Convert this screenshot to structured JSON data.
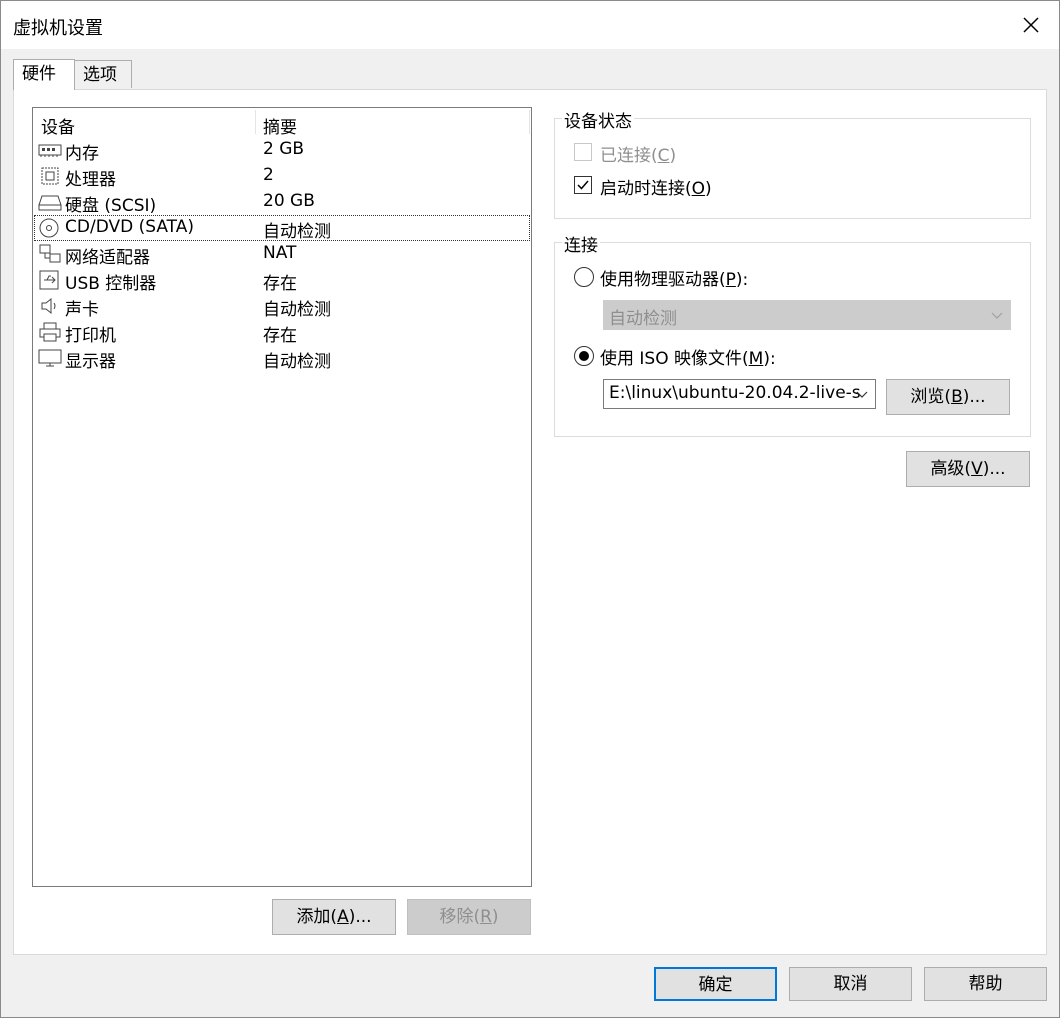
{
  "window": {
    "title": "虚拟机设置"
  },
  "tabs": [
    {
      "label": "硬件"
    },
    {
      "label": "选项"
    }
  ],
  "device_list": {
    "headers": {
      "device": "设备",
      "summary": "摘要"
    },
    "rows": [
      {
        "name": "内存",
        "summary": "2 GB",
        "icon": "memory-icon"
      },
      {
        "name": "处理器",
        "summary": "2",
        "icon": "processor-icon"
      },
      {
        "name": "硬盘 (SCSI)",
        "summary": "20 GB",
        "icon": "hard-disk-icon"
      },
      {
        "name": "CD/DVD (SATA)",
        "summary": "自动检测",
        "icon": "cd-dvd-icon",
        "selected": true
      },
      {
        "name": "网络适配器",
        "summary": "NAT",
        "icon": "network-adapter-icon"
      },
      {
        "name": "USB 控制器",
        "summary": "存在",
        "icon": "usb-icon"
      },
      {
        "name": "声卡",
        "summary": "自动检测",
        "icon": "speaker-icon"
      },
      {
        "name": "打印机",
        "summary": "存在",
        "icon": "printer-icon"
      },
      {
        "name": "显示器",
        "summary": "自动检测",
        "icon": "monitor-icon"
      }
    ]
  },
  "list_buttons": {
    "add": {
      "text": "添加(",
      "key": "A",
      "suffix": ")..."
    },
    "remove": {
      "text": "移除(",
      "key": "R",
      "suffix": ")"
    }
  },
  "device_status": {
    "title": "设备状态",
    "connected": {
      "text": "已连接(",
      "key": "C",
      "suffix": ")",
      "checked": false,
      "enabled": false
    },
    "connect_at_power_on": {
      "text": "启动时连接(",
      "key": "O",
      "suffix": ")",
      "checked": true,
      "enabled": true
    }
  },
  "connection": {
    "title": "连接",
    "physical": {
      "text": "使用物理驱动器(",
      "key": "P",
      "suffix": "):",
      "selected": false
    },
    "physical_drive_value": "自动检测",
    "iso": {
      "text": "使用 ISO 映像文件(",
      "key": "M",
      "suffix": "):",
      "selected": true
    },
    "iso_path": "E:\\linux\\ubuntu-20.04.2-live-s",
    "browse": {
      "text": "浏览(",
      "key": "B",
      "suffix": ")..."
    }
  },
  "advanced": {
    "text": "高级(",
    "key": "V",
    "suffix": ")..."
  },
  "footer": {
    "ok": "确定",
    "cancel": "取消",
    "help": "帮助"
  },
  "colors": {
    "dialog_bg": "#f0f0f0",
    "accent": "#0078d7",
    "disabled_text": "#8f8f8f"
  }
}
